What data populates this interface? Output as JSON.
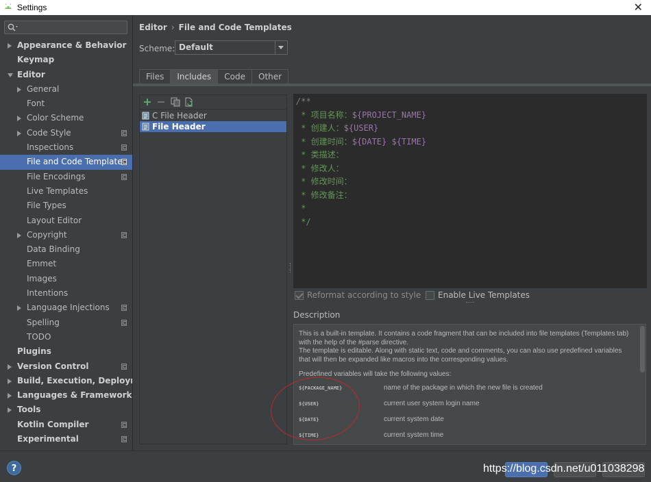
{
  "window": {
    "title": "Settings",
    "close_glyph": "✕"
  },
  "search": {
    "placeholder": ""
  },
  "sidebar": {
    "items": [
      {
        "label": "Appearance & Behavior",
        "level": 0,
        "bold": true,
        "arrow": "right",
        "proj": false
      },
      {
        "label": "Keymap",
        "level": 0,
        "bold": true,
        "arrow": "",
        "proj": false
      },
      {
        "label": "Editor",
        "level": 0,
        "bold": true,
        "arrow": "down",
        "proj": false
      },
      {
        "label": "General",
        "level": 1,
        "bold": false,
        "arrow": "right",
        "proj": false
      },
      {
        "label": "Font",
        "level": 1,
        "bold": false,
        "arrow": "",
        "proj": false
      },
      {
        "label": "Color Scheme",
        "level": 1,
        "bold": false,
        "arrow": "right",
        "proj": false
      },
      {
        "label": "Code Style",
        "level": 1,
        "bold": false,
        "arrow": "right",
        "proj": true
      },
      {
        "label": "Inspections",
        "level": 1,
        "bold": false,
        "arrow": "",
        "proj": true
      },
      {
        "label": "File and Code Templates",
        "level": 1,
        "bold": false,
        "arrow": "",
        "proj": true,
        "selected": true
      },
      {
        "label": "File Encodings",
        "level": 1,
        "bold": false,
        "arrow": "",
        "proj": true
      },
      {
        "label": "Live Templates",
        "level": 1,
        "bold": false,
        "arrow": "",
        "proj": false
      },
      {
        "label": "File Types",
        "level": 1,
        "bold": false,
        "arrow": "",
        "proj": false
      },
      {
        "label": "Layout Editor",
        "level": 1,
        "bold": false,
        "arrow": "",
        "proj": false
      },
      {
        "label": "Copyright",
        "level": 1,
        "bold": false,
        "arrow": "right",
        "proj": true
      },
      {
        "label": "Data Binding",
        "level": 1,
        "bold": false,
        "arrow": "",
        "proj": false
      },
      {
        "label": "Emmet",
        "level": 1,
        "bold": false,
        "arrow": "",
        "proj": false
      },
      {
        "label": "Images",
        "level": 1,
        "bold": false,
        "arrow": "",
        "proj": false
      },
      {
        "label": "Intentions",
        "level": 1,
        "bold": false,
        "arrow": "",
        "proj": false
      },
      {
        "label": "Language Injections",
        "level": 1,
        "bold": false,
        "arrow": "right",
        "proj": true
      },
      {
        "label": "Spelling",
        "level": 1,
        "bold": false,
        "arrow": "",
        "proj": true
      },
      {
        "label": "TODO",
        "level": 1,
        "bold": false,
        "arrow": "",
        "proj": false
      },
      {
        "label": "Plugins",
        "level": 0,
        "bold": true,
        "arrow": "",
        "proj": false
      },
      {
        "label": "Version Control",
        "level": 0,
        "bold": true,
        "arrow": "right",
        "proj": true
      },
      {
        "label": "Build, Execution, Deployment",
        "level": 0,
        "bold": true,
        "arrow": "right",
        "proj": false
      },
      {
        "label": "Languages & Frameworks",
        "level": 0,
        "bold": true,
        "arrow": "right",
        "proj": false
      },
      {
        "label": "Tools",
        "level": 0,
        "bold": true,
        "arrow": "right",
        "proj": false
      },
      {
        "label": "Kotlin Compiler",
        "level": 0,
        "bold": true,
        "arrow": "",
        "proj": true
      },
      {
        "label": "Experimental",
        "level": 0,
        "bold": true,
        "arrow": "",
        "proj": true
      }
    ]
  },
  "breadcrumb": {
    "parent": "Editor",
    "separator": "›",
    "current": "File and Code Templates"
  },
  "scheme": {
    "label": "Scheme:",
    "value": "Default"
  },
  "tabs": [
    {
      "label": "Files",
      "active": false
    },
    {
      "label": "Includes",
      "active": true
    },
    {
      "label": "Code",
      "active": false
    },
    {
      "label": "Other",
      "active": false
    }
  ],
  "templates": [
    {
      "label": "C File Header",
      "selected": false
    },
    {
      "label": "File Header",
      "selected": true
    }
  ],
  "editor": {
    "lines": [
      {
        "prefix": "/**",
        "var": ""
      },
      {
        "prefix": " * 项目名称：",
        "var": "${PROJECT_NAME}"
      },
      {
        "prefix": " * 创建人：",
        "var": "${USER}"
      },
      {
        "prefix": " * 创建时间：",
        "var": "${DATE} ${TIME}"
      },
      {
        "prefix": " * 类描述：",
        "var": ""
      },
      {
        "prefix": " * 修改人：",
        "var": ""
      },
      {
        "prefix": " * 修改时间：",
        "var": ""
      },
      {
        "prefix": " * 修改备注：",
        "var": ""
      },
      {
        "prefix": " *",
        "var": ""
      },
      {
        "prefix": " */",
        "var": ""
      }
    ]
  },
  "options": {
    "reformat": {
      "label": "Reformat according to style",
      "checked": true
    },
    "live_templates": {
      "label": "Enable Live Templates",
      "checked": false
    }
  },
  "description": {
    "label": "Description",
    "para1": "This is a built-in template. It contains a code fragment that can be included into file templates (Templates tab) with the help of the #parse directive.",
    "para2": "The template is editable. Along with static text, code and comments, you can also use predefined variables that will then be expanded like macros into the corresponding values.",
    "para3": "Predefined variables will take the following values:",
    "vars": [
      {
        "name": "${PACKAGE_NAME}",
        "desc": "name of the package in which the new file is created"
      },
      {
        "name": "${USER}",
        "desc": "current user system login name"
      },
      {
        "name": "${DATE}",
        "desc": "current system date"
      },
      {
        "name": "${TIME}",
        "desc": "current system time"
      }
    ]
  },
  "footer": {
    "help_glyph": "?",
    "watermark": "https://blog.csdn.net/u011038298"
  },
  "colors": {
    "accent": "#4b6eaf",
    "background": "#3c3f41",
    "editor_bg": "#2b2b2b",
    "comment_green": "#629755",
    "variable_purple": "#9876aa",
    "annotation_red": "#c0262c"
  }
}
